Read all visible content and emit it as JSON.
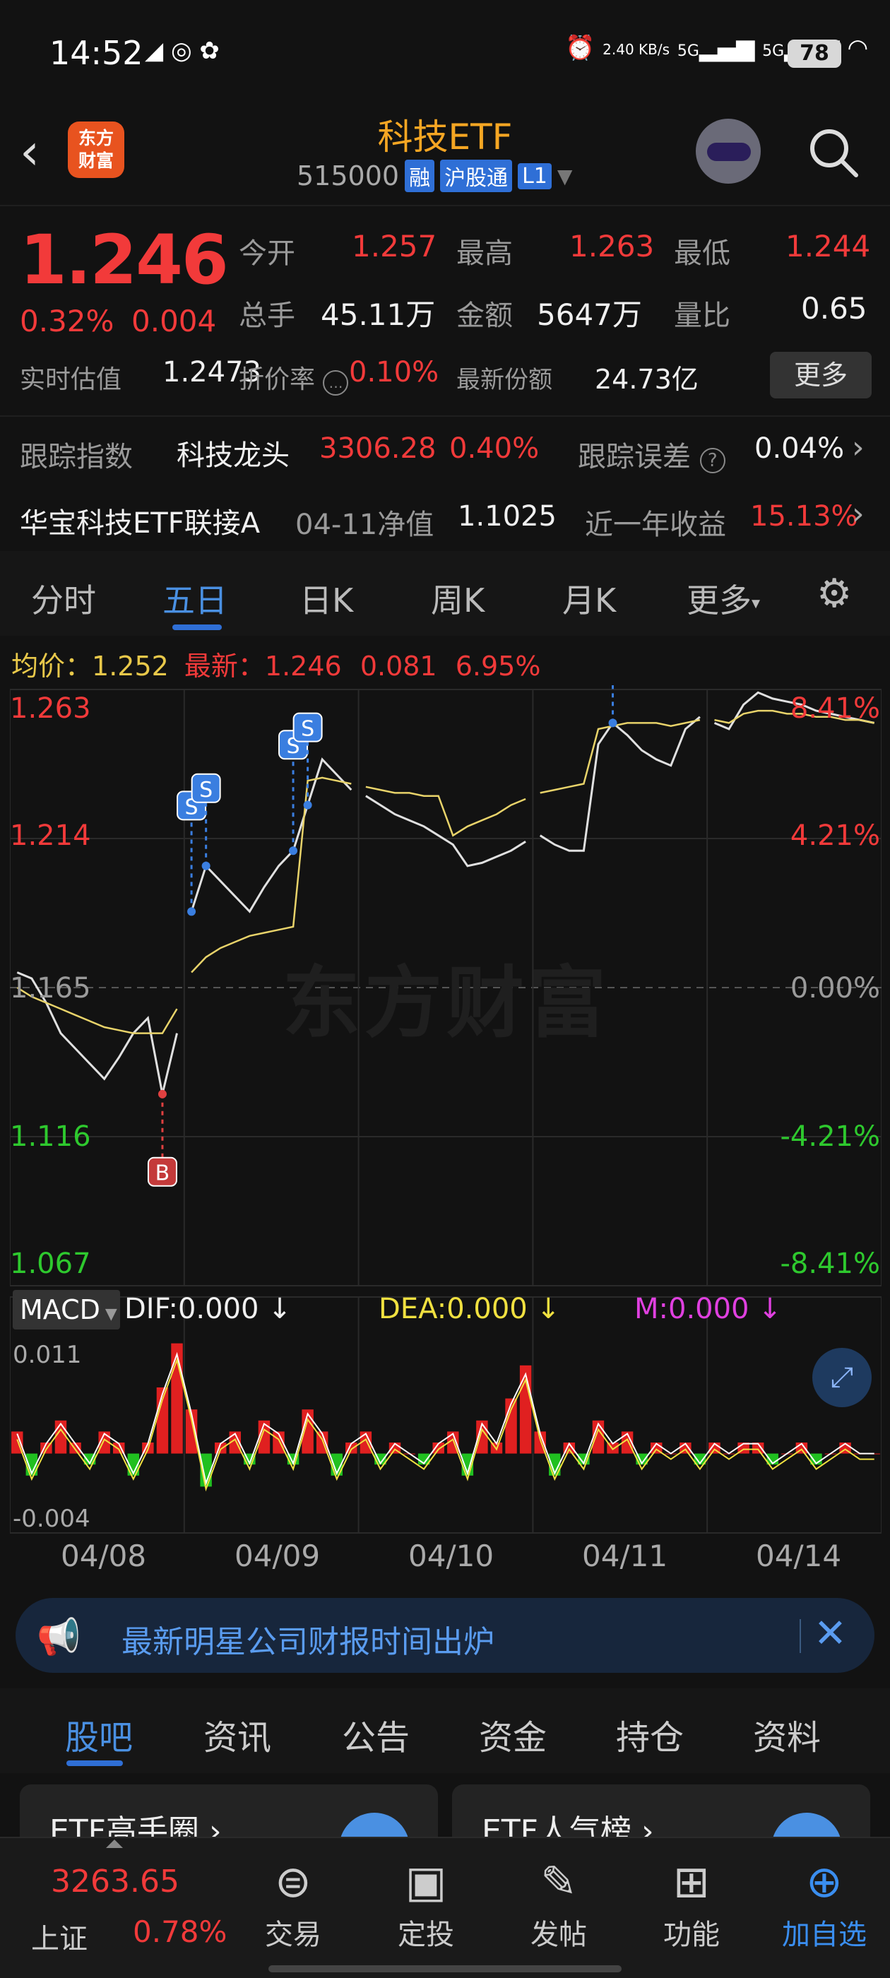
{
  "status_bar": {
    "time": "14:52",
    "net_speed": "2.40 KB/s",
    "signal1": "5G",
    "signal2": "5G",
    "battery": "78"
  },
  "header": {
    "back_icon": "chevron-left-icon",
    "logo": "东方\n财富",
    "title": "科技ETF",
    "code": "515000",
    "tags": [
      "融",
      "沪股通",
      "L1"
    ],
    "search_icon": "search-icon"
  },
  "quote": {
    "price": "1.246",
    "change_pct": "0.32%",
    "change_abs": "0.004",
    "open_label": "今开",
    "open": "1.257",
    "high_label": "最高",
    "high": "1.263",
    "low_label": "最低",
    "low": "1.244",
    "volume_label": "总手",
    "volume": "45.11万",
    "amount_label": "金额",
    "amount": "5647万",
    "ratio_label": "量比",
    "ratio": "0.65",
    "est_label": "实时估值",
    "est": "1.2473",
    "premium_label": "折价率",
    "premium": "0.10%",
    "shares_label": "最新份额",
    "shares": "24.73亿",
    "more": "更多",
    "track_index_label": "跟踪指数",
    "track_index_name": "科技龙头",
    "track_index_value": "3306.28",
    "track_index_pct": "0.40%",
    "track_error_label": "跟踪误差",
    "track_error": "0.04%",
    "fund_name": "华宝科技ETF联接A",
    "nav_label": "04-11净值",
    "nav": "1.1025",
    "yearly_label": "近一年收益",
    "yearly": "15.13%"
  },
  "tabs": [
    "分时",
    "五日",
    "日K",
    "周K",
    "月K",
    "更多"
  ],
  "active_tab": "五日",
  "chart_info": {
    "avg_label": "均价：",
    "avg": "1.252",
    "latest_label": "最新：",
    "latest": "1.246",
    "latest_chg": "0.081",
    "latest_pct": "6.95%",
    "watermark": "东方财富",
    "macd_label": "MACD",
    "dif": "DIF:0.000 ↓",
    "dea": "DEA:0.000 ↓",
    "m": "M:0.000 ↓",
    "macd_hi": "0.011",
    "macd_lo": "-0.004"
  },
  "chart_data": {
    "type": "line",
    "y_left_ticks": [
      "1.263",
      "1.214",
      "1.165",
      "1.116",
      "1.067"
    ],
    "y_right_ticks": [
      "8.41%",
      "4.21%",
      "0.00%",
      "-4.21%",
      "-8.41%"
    ],
    "ylim": [
      1.067,
      1.263
    ],
    "x_days": [
      "04/08",
      "04/09",
      "04/10",
      "04/11",
      "04/14"
    ],
    "series": [
      {
        "name": "价格",
        "color": "#e0e0e0",
        "values": [
          1.17,
          1.168,
          1.16,
          1.15,
          1.145,
          1.14,
          1.135,
          1.142,
          1.15,
          1.155,
          1.13,
          1.15,
          1.19,
          1.205,
          1.2,
          1.195,
          1.19,
          1.198,
          1.205,
          1.21,
          1.225,
          1.24,
          1.235,
          1.23,
          1.228,
          1.225,
          1.222,
          1.22,
          1.218,
          1.215,
          1.212,
          1.205,
          1.206,
          1.208,
          1.21,
          1.213,
          1.215,
          1.212,
          1.21,
          1.21,
          1.245,
          1.252,
          1.248,
          1.243,
          1.24,
          1.238,
          1.25,
          1.254,
          1.252,
          1.25,
          1.258,
          1.262,
          1.26,
          1.259,
          1.258,
          1.256,
          1.255,
          1.254,
          1.253,
          1.252
        ]
      },
      {
        "name": "均价",
        "color": "#e8d36a",
        "values": [
          1.165,
          1.162,
          1.16,
          1.158,
          1.156,
          1.154,
          1.152,
          1.151,
          1.15,
          1.15,
          1.15,
          1.158,
          1.17,
          1.175,
          1.178,
          1.18,
          1.182,
          1.183,
          1.184,
          1.185,
          1.233,
          1.234,
          1.233,
          1.232,
          1.231,
          1.23,
          1.229,
          1.229,
          1.228,
          1.228,
          1.215,
          1.218,
          1.22,
          1.222,
          1.225,
          1.227,
          1.229,
          1.23,
          1.231,
          1.232,
          1.25,
          1.251,
          1.252,
          1.252,
          1.252,
          1.251,
          1.252,
          1.253,
          1.253,
          1.252,
          1.255,
          1.256,
          1.256,
          1.255,
          1.255,
          1.254,
          1.254,
          1.253,
          1.253,
          1.252
        ]
      }
    ],
    "markers": [
      {
        "label": "B",
        "index": 10
      },
      {
        "label": "S",
        "index": 12
      },
      {
        "label": "S",
        "index": 13
      },
      {
        "label": "S",
        "index": 19
      },
      {
        "label": "S",
        "index": 20
      },
      {
        "label": "S",
        "index": 41
      }
    ],
    "macd": {
      "ylim": [
        -0.004,
        0.011
      ],
      "hist": [
        0.002,
        -0.002,
        0.001,
        0.003,
        0.001,
        -0.001,
        0.002,
        0.001,
        -0.002,
        0.001,
        0.006,
        0.01,
        0.004,
        -0.003,
        0.001,
        0.002,
        -0.001,
        0.003,
        0.002,
        -0.001,
        0.004,
        0.002,
        -0.002,
        0.001,
        0.002,
        -0.001,
        0.001,
        0.0,
        -0.001,
        0.001,
        0.002,
        -0.002,
        0.003,
        0.001,
        0.005,
        0.008,
        0.002,
        -0.002,
        0.001,
        -0.001,
        0.003,
        0.001,
        0.002,
        -0.001,
        0.001,
        0.0,
        0.001,
        -0.001,
        0.001,
        0.0,
        0.001,
        0.001,
        -0.001,
        0.0,
        0.001,
        -0.001,
        0.0,
        0.001,
        0.0,
        0.0
      ]
    }
  },
  "notice": {
    "text": "最新明星公司财报时间出炉",
    "icon": "megaphone-icon",
    "close_icon": "close-icon"
  },
  "sub_tabs": [
    "股吧",
    "资讯",
    "公告",
    "资金",
    "持仓",
    "资料"
  ],
  "active_sub_tab": "股吧",
  "cards": [
    {
      "title": "ETF高手圈 ›"
    },
    {
      "title": "ETF人气榜 ›"
    }
  ],
  "nav": {
    "index_value": "3263.65",
    "index_name": "上证",
    "index_pct": "0.78%",
    "items": [
      {
        "label": "交易",
        "icon": "trade-icon"
      },
      {
        "label": "定投",
        "icon": "invest-icon"
      },
      {
        "label": "发帖",
        "icon": "post-icon"
      },
      {
        "label": "功能",
        "icon": "grid-icon"
      },
      {
        "label": "加自选",
        "icon": "add-favorite-icon"
      }
    ]
  }
}
